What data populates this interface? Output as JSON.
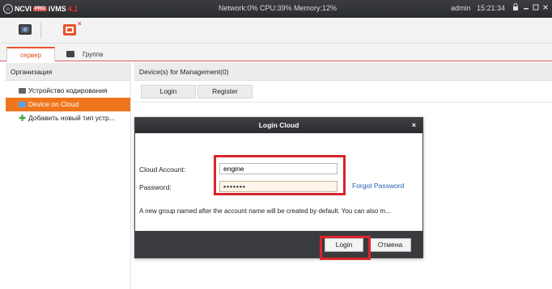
{
  "titlebar": {
    "logo_brand": "NCVI",
    "logo_badge": "PRO",
    "logo_product": "iVMS",
    "logo_version": "4.1",
    "system_status": "Network:0%  CPU:39%  Memory:12%",
    "user": "admin",
    "clock": "15:21:34"
  },
  "tabs": [
    {
      "label": "сервер"
    },
    {
      "label": "Группа"
    }
  ],
  "left_panel": {
    "title": "Организация",
    "items": [
      {
        "label": "Устройство кодирования"
      },
      {
        "label": "Device on Cloud"
      },
      {
        "label": "Добавить новый тип устр..."
      }
    ]
  },
  "main_panel": {
    "title": "Device(s) for Management(0)",
    "login_label": "Login",
    "register_label": "Register"
  },
  "modal": {
    "title": "Login Cloud",
    "close_glyph": "×",
    "account_label": "Cloud Account:",
    "account_value": "engine",
    "password_label": "Password:",
    "password_value": "•••••••",
    "forgot_label": "Forgot Password",
    "info_text": "A new group named after the account name will be created  by default. You can also m...",
    "login_label": "Login",
    "cancel_label": "Отмена"
  },
  "colors": {
    "accent": "#f0761e",
    "highlight": "#d8252c",
    "titlebar": "#2c2d30",
    "link": "#1f5fb7"
  }
}
